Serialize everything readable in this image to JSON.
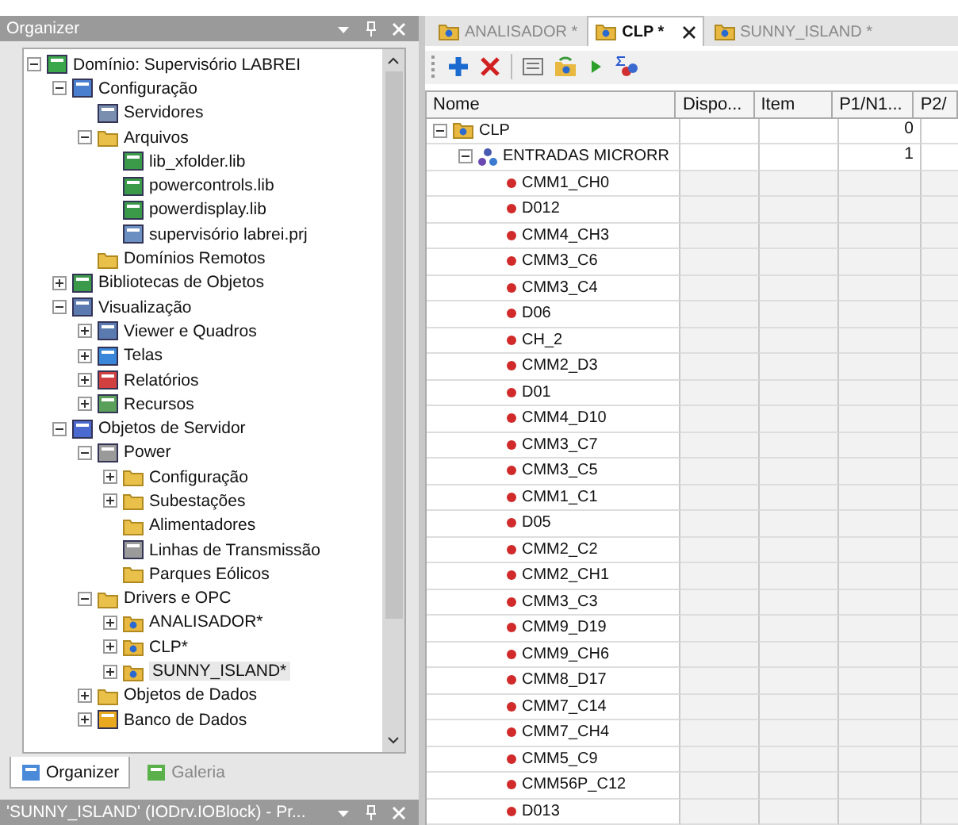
{
  "organizer": {
    "title": "Organizer",
    "tree": [
      {
        "label": "Domínio: Supervisório LABREI",
        "kind": "domain",
        "expanded": true,
        "selected": false,
        "children": [
          {
            "label": "Configuração",
            "kind": "config",
            "expanded": true,
            "selected": false,
            "children": [
              {
                "label": "Servidores",
                "kind": "server",
                "selected": false
              },
              {
                "label": "Arquivos",
                "kind": "folder",
                "expanded": true,
                "selected": false,
                "children": [
                  {
                    "label": "lib_xfolder.lib",
                    "kind": "lib",
                    "selected": false
                  },
                  {
                    "label": "powercontrols.lib",
                    "kind": "lib",
                    "selected": false
                  },
                  {
                    "label": "powerdisplay.lib",
                    "kind": "lib",
                    "selected": false
                  },
                  {
                    "label": "supervisório labrei.prj",
                    "kind": "project",
                    "selected": false
                  }
                ]
              },
              {
                "label": "Domínios Remotos",
                "kind": "folder",
                "selected": false
              }
            ]
          },
          {
            "label": "Bibliotecas de Objetos",
            "kind": "lib",
            "expanded": false,
            "selected": false
          },
          {
            "label": "Visualização",
            "kind": "view",
            "expanded": true,
            "selected": false,
            "children": [
              {
                "label": "Viewer e Quadros",
                "kind": "view",
                "expanded": false,
                "selected": false
              },
              {
                "label": "Telas",
                "kind": "screen",
                "expanded": false,
                "selected": false
              },
              {
                "label": "Relatórios",
                "kind": "report",
                "expanded": false,
                "selected": false
              },
              {
                "label": "Recursos",
                "kind": "resource",
                "expanded": false,
                "selected": false
              }
            ]
          },
          {
            "label": "Objetos de Servidor",
            "kind": "gears",
            "expanded": true,
            "selected": false,
            "children": [
              {
                "label": "Power",
                "kind": "power",
                "expanded": true,
                "selected": false,
                "children": [
                  {
                    "label": "Configuração",
                    "kind": "folder",
                    "expanded": false,
                    "selected": false
                  },
                  {
                    "label": "Subestações",
                    "kind": "folder",
                    "expanded": false,
                    "selected": false
                  },
                  {
                    "label": "Alimentadores",
                    "kind": "folder",
                    "selected": false
                  },
                  {
                    "label": "Linhas de Transmissão",
                    "kind": "tower",
                    "selected": false
                  },
                  {
                    "label": "Parques Eólicos",
                    "kind": "folder",
                    "selected": false
                  }
                ]
              },
              {
                "label": "Drivers e OPC",
                "kind": "folder",
                "expanded": true,
                "selected": false,
                "children": [
                  {
                    "label": "ANALISADOR*",
                    "kind": "driver",
                    "expanded": false,
                    "selected": false
                  },
                  {
                    "label": "CLP*",
                    "kind": "driver",
                    "expanded": false,
                    "selected": false
                  },
                  {
                    "label": "SUNNY_ISLAND*",
                    "kind": "driver",
                    "expanded": false,
                    "selected": true
                  }
                ]
              },
              {
                "label": "Objetos de Dados",
                "kind": "folder",
                "expanded": false,
                "selected": false
              },
              {
                "label": "Banco de Dados",
                "kind": "database",
                "expanded": false,
                "selected": false
              }
            ]
          }
        ]
      }
    ],
    "tabs": [
      {
        "label": "Organizer",
        "selected": true
      },
      {
        "label": "Galeria",
        "selected": false
      }
    ]
  },
  "properties_panel": {
    "title": "'SUNNY_ISLAND' (IODrv.IOBlock) - Pr..."
  },
  "document_tabs": [
    {
      "label": "ANALISADOR *",
      "selected": false
    },
    {
      "label": "CLP *",
      "selected": true
    },
    {
      "label": "SUNNY_ISLAND *",
      "selected": false
    }
  ],
  "table": {
    "columns": [
      "Nome",
      "Dispo...",
      "Item",
      "P1/N1...",
      "P2/"
    ],
    "rows": [
      {
        "name": "CLP",
        "kind": "driver",
        "expanded": true,
        "p1": "0",
        "children": [
          {
            "name": "ENTRADAS MICRORR",
            "kind": "block",
            "expanded": true,
            "p1": "1",
            "children": [
              {
                "name": "CMM1_CH0",
                "kind": "tag"
              },
              {
                "name": "D012",
                "kind": "tag"
              },
              {
                "name": "CMM4_CH3",
                "kind": "tag"
              },
              {
                "name": "CMM3_C6",
                "kind": "tag"
              },
              {
                "name": "CMM3_C4",
                "kind": "tag"
              },
              {
                "name": "D06",
                "kind": "tag"
              },
              {
                "name": "CH_2",
                "kind": "tag"
              },
              {
                "name": "CMM2_D3",
                "kind": "tag"
              },
              {
                "name": "D01",
                "kind": "tag"
              },
              {
                "name": "CMM4_D10",
                "kind": "tag"
              },
              {
                "name": "CMM3_C7",
                "kind": "tag"
              },
              {
                "name": "CMM3_C5",
                "kind": "tag"
              },
              {
                "name": "CMM1_C1",
                "kind": "tag"
              },
              {
                "name": "D05",
                "kind": "tag"
              },
              {
                "name": "CMM2_C2",
                "kind": "tag"
              },
              {
                "name": "CMM2_CH1",
                "kind": "tag"
              },
              {
                "name": "CMM3_C3",
                "kind": "tag"
              },
              {
                "name": "CMM9_D19",
                "kind": "tag"
              },
              {
                "name": "CMM9_CH6",
                "kind": "tag"
              },
              {
                "name": "CMM8_D17",
                "kind": "tag"
              },
              {
                "name": "CMM7_C14",
                "kind": "tag"
              },
              {
                "name": "CMM7_CH4",
                "kind": "tag"
              },
              {
                "name": "CMM5_C9",
                "kind": "tag"
              },
              {
                "name": "CMM56P_C12",
                "kind": "tag"
              },
              {
                "name": "D013",
                "kind": "tag"
              }
            ]
          }
        ]
      }
    ]
  }
}
